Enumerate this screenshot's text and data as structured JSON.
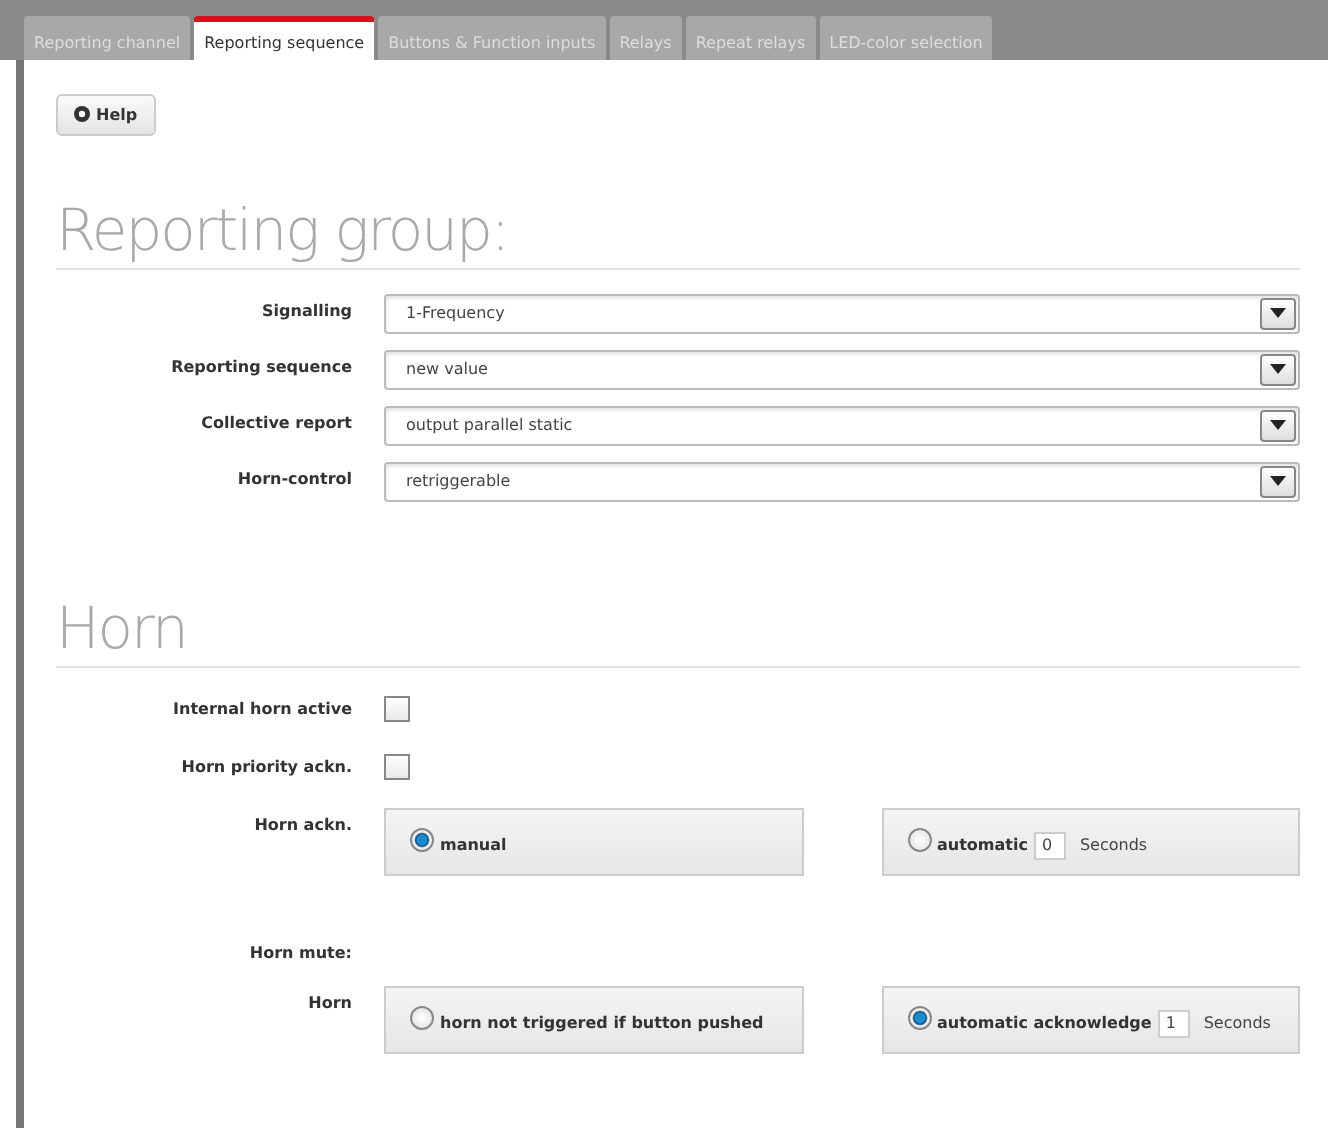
{
  "tabs": [
    {
      "label": "Reporting channel",
      "selected": false
    },
    {
      "label": "Reporting sequence",
      "selected": true
    },
    {
      "label": "Buttons & Function inputs",
      "selected": false
    },
    {
      "label": "Relays",
      "selected": false
    },
    {
      "label": "Repeat relays",
      "selected": false
    },
    {
      "label": "LED-color selection",
      "selected": false
    }
  ],
  "help_button": "Help",
  "reporting_group": {
    "title": "Reporting group:",
    "fields": [
      {
        "label": "Signalling",
        "value": "1-Frequency"
      },
      {
        "label": "Reporting sequence",
        "value": "new value"
      },
      {
        "label": "Collective report",
        "value": "output parallel static"
      },
      {
        "label": "Horn-control",
        "value": "retriggerable"
      }
    ]
  },
  "horn": {
    "title": "Horn",
    "checkboxes": [
      {
        "label": "Internal horn active",
        "checked": false
      },
      {
        "label": "Horn priority ackn.",
        "checked": false
      }
    ],
    "horn_ackn": {
      "label": "Horn ackn.",
      "options": [
        {
          "label": "manual",
          "selected": true
        },
        {
          "label": "automatic",
          "selected": false,
          "seconds": "0",
          "unit": "Seconds"
        }
      ]
    },
    "horn_mute_label": "Horn mute:",
    "horn_mute": {
      "label": "Horn",
      "options": [
        {
          "label": "horn not triggered if button pushed",
          "selected": false
        },
        {
          "label": "automatic acknowledge",
          "selected": true,
          "seconds": "1",
          "unit": "Seconds"
        }
      ]
    }
  }
}
